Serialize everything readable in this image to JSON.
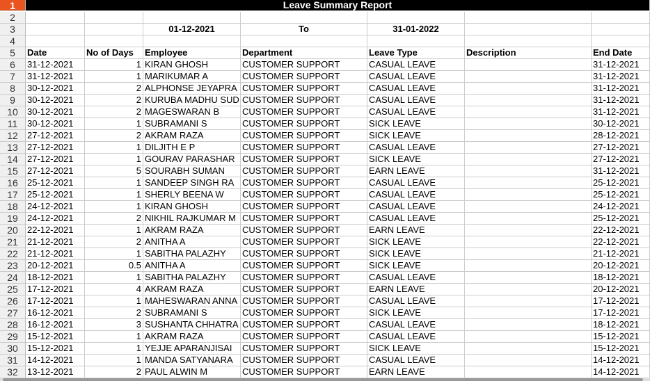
{
  "title": "Leave Summary Report",
  "range": {
    "from": "01-12-2021",
    "to_label": "To",
    "to": "31-01-2022"
  },
  "headers": [
    "Date",
    "No of Days",
    "Employee",
    "Department",
    "Leave Type",
    "Description",
    "End Date"
  ],
  "rows": [
    [
      "31-12-2021",
      "1",
      "KIRAN GHOSH",
      "CUSTOMER SUPPORT",
      "CASUAL LEAVE",
      "",
      "31-12-2021"
    ],
    [
      "31-12-2021",
      "1",
      "MARIKUMAR A",
      "CUSTOMER SUPPORT",
      "CASUAL LEAVE",
      "",
      "31-12-2021"
    ],
    [
      "30-12-2021",
      "2",
      "ALPHONSE JEYAPRA",
      "CUSTOMER SUPPORT",
      "CASUAL LEAVE",
      "",
      "31-12-2021"
    ],
    [
      "30-12-2021",
      "2",
      "KURUBA MADHU SUD",
      "CUSTOMER SUPPORT",
      "CASUAL LEAVE",
      "",
      "31-12-2021"
    ],
    [
      "30-12-2021",
      "2",
      "MAGESWARAN B",
      "CUSTOMER SUPPORT",
      "CASUAL LEAVE",
      "",
      "31-12-2021"
    ],
    [
      "30-12-2021",
      "1",
      "SUBRAMANI S",
      "CUSTOMER SUPPORT",
      "SICK LEAVE",
      "",
      "30-12-2021"
    ],
    [
      "27-12-2021",
      "2",
      "AKRAM RAZA",
      "CUSTOMER SUPPORT",
      "SICK LEAVE",
      "",
      "28-12-2021"
    ],
    [
      "27-12-2021",
      "1",
      "DILJITH E P",
      "CUSTOMER SUPPORT",
      "CASUAL LEAVE",
      "",
      "27-12-2021"
    ],
    [
      "27-12-2021",
      "1",
      "GOURAV PARASHAR",
      "CUSTOMER SUPPORT",
      "SICK LEAVE",
      "",
      "27-12-2021"
    ],
    [
      "27-12-2021",
      "5",
      "SOURABH SUMAN",
      "CUSTOMER SUPPORT",
      "EARN LEAVE",
      "",
      "31-12-2021"
    ],
    [
      "25-12-2021",
      "1",
      "SANDEEP SINGH RA",
      "CUSTOMER SUPPORT",
      "CASUAL LEAVE",
      "",
      "25-12-2021"
    ],
    [
      "25-12-2021",
      "1",
      "SHERLY BEENA W",
      "CUSTOMER SUPPORT",
      "CASUAL LEAVE",
      "",
      "25-12-2021"
    ],
    [
      "24-12-2021",
      "1",
      "KIRAN GHOSH",
      "CUSTOMER SUPPORT",
      "CASUAL LEAVE",
      "",
      "24-12-2021"
    ],
    [
      "24-12-2021",
      "2",
      "NIKHIL RAJKUMAR M",
      "CUSTOMER SUPPORT",
      "CASUAL LEAVE",
      "",
      "25-12-2021"
    ],
    [
      "22-12-2021",
      "1",
      "AKRAM RAZA",
      "CUSTOMER SUPPORT",
      "EARN LEAVE",
      "",
      "22-12-2021"
    ],
    [
      "21-12-2021",
      "2",
      "ANITHA A",
      "CUSTOMER SUPPORT",
      "SICK LEAVE",
      "",
      "22-12-2021"
    ],
    [
      "21-12-2021",
      "1",
      "SABITHA PALAZHY",
      "CUSTOMER SUPPORT",
      "SICK LEAVE",
      "",
      "21-12-2021"
    ],
    [
      "20-12-2021",
      "0.5",
      "ANITHA A",
      "CUSTOMER SUPPORT",
      "SICK LEAVE",
      "",
      "20-12-2021"
    ],
    [
      "18-12-2021",
      "1",
      "SABITHA PALAZHY",
      "CUSTOMER SUPPORT",
      "CASUAL LEAVE",
      "",
      "18-12-2021"
    ],
    [
      "17-12-2021",
      "4",
      "AKRAM RAZA",
      "CUSTOMER SUPPORT",
      "EARN LEAVE",
      "",
      "20-12-2021"
    ],
    [
      "17-12-2021",
      "1",
      "MAHESWARAN ANNA",
      "CUSTOMER SUPPORT",
      "CASUAL LEAVE",
      "",
      "17-12-2021"
    ],
    [
      "16-12-2021",
      "2",
      "SUBRAMANI S",
      "CUSTOMER SUPPORT",
      "SICK LEAVE",
      "",
      "17-12-2021"
    ],
    [
      "16-12-2021",
      "3",
      "SUSHANTA CHHATRA",
      "CUSTOMER SUPPORT",
      "CASUAL LEAVE",
      "",
      "18-12-2021"
    ],
    [
      "15-12-2021",
      "1",
      "AKRAM RAZA",
      "CUSTOMER SUPPORT",
      "CASUAL LEAVE",
      "",
      "15-12-2021"
    ],
    [
      "15-12-2021",
      "1",
      "YEJJE APARANJISAI",
      "CUSTOMER SUPPORT",
      "SICK LEAVE",
      "",
      "15-12-2021"
    ],
    [
      "14-12-2021",
      "1",
      "MANDA SATYANARA",
      "CUSTOMER SUPPORT",
      "CASUAL LEAVE",
      "",
      "14-12-2021"
    ],
    [
      "13-12-2021",
      "2",
      "PAUL ALWIN M",
      "CUSTOMER SUPPORT",
      "EARN LEAVE",
      "",
      "14-12-2021"
    ]
  ]
}
